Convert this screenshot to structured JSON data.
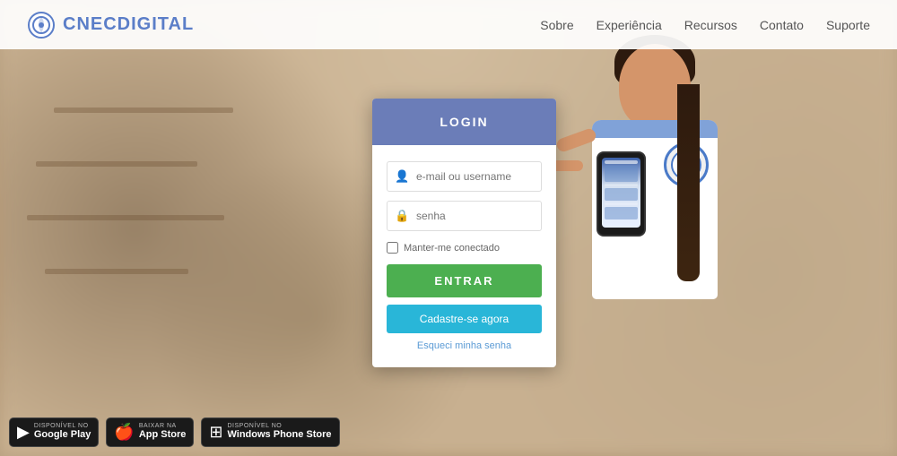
{
  "header": {
    "logo_text": "CNEC",
    "logo_suffix": "DIGITAL",
    "nav": {
      "sobre": "Sobre",
      "experiencia": "Experiência",
      "recursos": "Recursos",
      "contato": "Contato",
      "suporte": "Suporte"
    }
  },
  "login": {
    "title": "LOGIN",
    "email_placeholder": "e-mail ou username",
    "password_placeholder": "senha",
    "remember_label": "Manter-me conectado",
    "enter_button": "ENTRAR",
    "register_button": "Cadastre-se agora",
    "forgot_link": "Esqueci minha senha"
  },
  "badges": [
    {
      "id": "google-play",
      "sub": "DISPONÍVEL NO",
      "name": "Google Play",
      "icon": "▶"
    },
    {
      "id": "app-store",
      "sub": "Baixar na",
      "name": "App Store",
      "icon": ""
    },
    {
      "id": "windows-phone",
      "sub": "Disponível no",
      "name": "Windows Phone Store",
      "icon": "⊞"
    }
  ],
  "colors": {
    "header_bg": "#6b7db8",
    "enter_btn": "#4caf50",
    "register_btn": "#29b6d8",
    "logo_accent": "#5b7ec8"
  }
}
